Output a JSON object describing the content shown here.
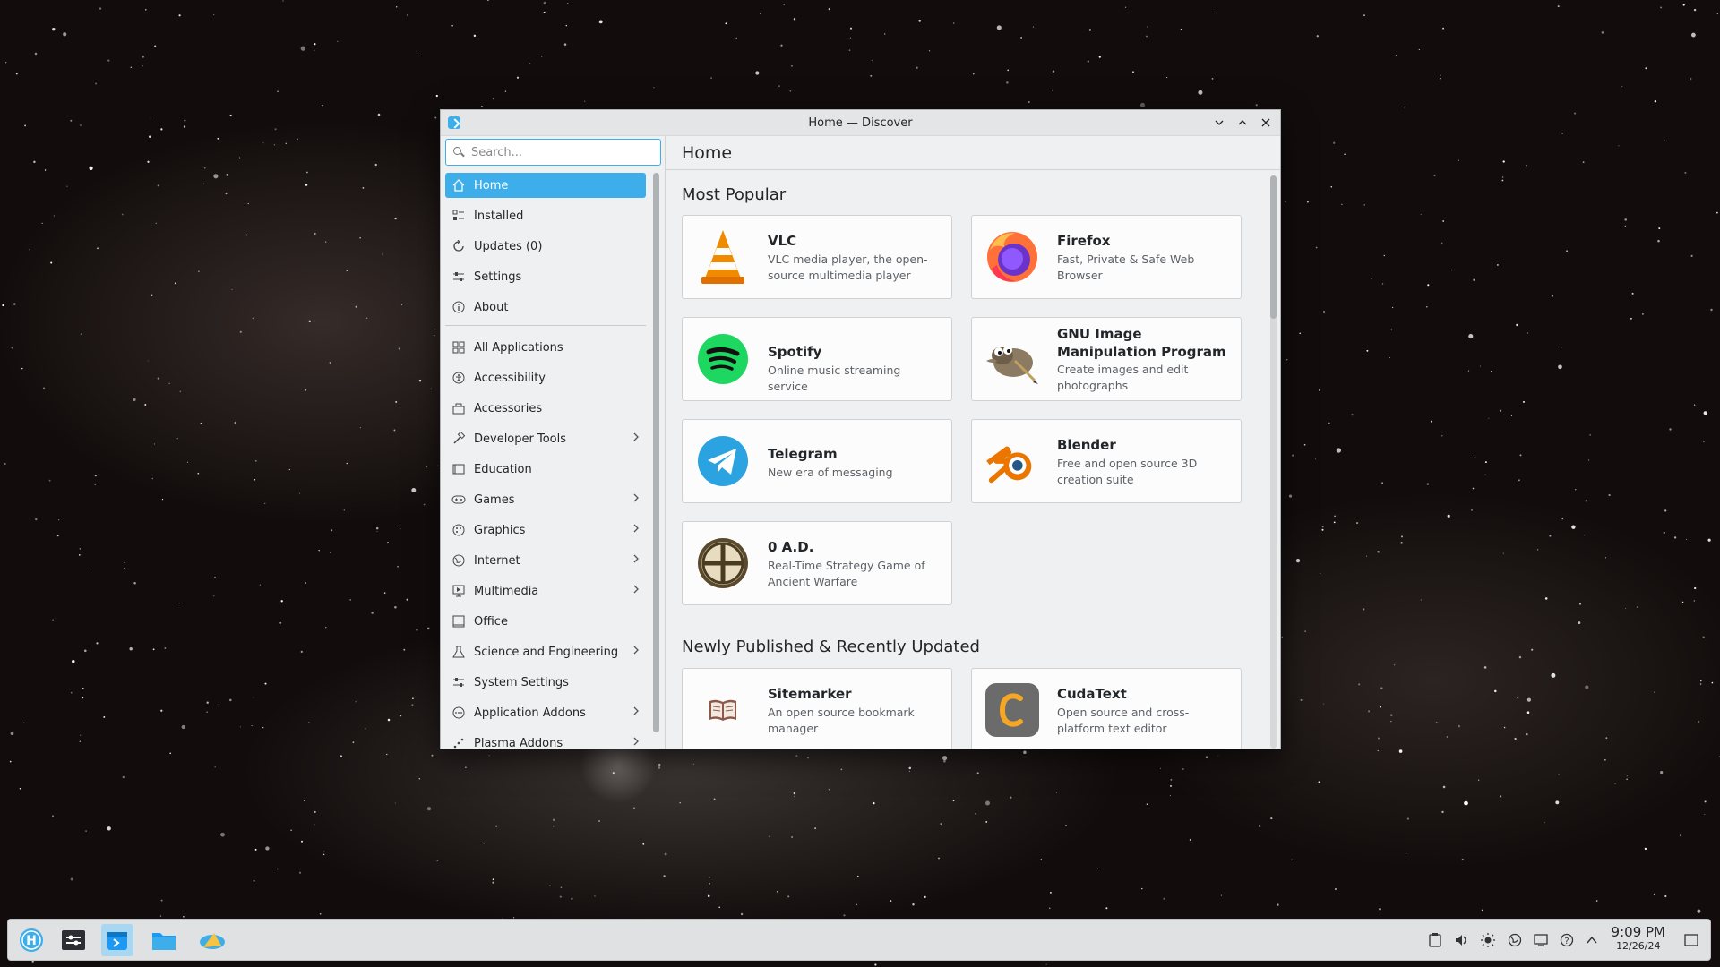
{
  "window": {
    "title": "Home — Discover"
  },
  "search": {
    "placeholder": "Search..."
  },
  "sidebar": {
    "top_items": [
      {
        "label": "Home",
        "icon": "home-icon",
        "active": true
      },
      {
        "label": "Installed",
        "icon": "installed-icon"
      },
      {
        "label": "Updates (0)",
        "icon": "updates-icon"
      },
      {
        "label": "Settings",
        "icon": "settings-icon"
      },
      {
        "label": "About",
        "icon": "about-icon"
      }
    ],
    "categories": [
      {
        "label": "All Applications",
        "icon": "grid-icon",
        "chevron": false
      },
      {
        "label": "Accessibility",
        "icon": "accessibility-icon",
        "chevron": false
      },
      {
        "label": "Accessories",
        "icon": "accessories-icon",
        "chevron": false
      },
      {
        "label": "Developer Tools",
        "icon": "hammer-icon",
        "chevron": true
      },
      {
        "label": "Education",
        "icon": "education-icon",
        "chevron": false
      },
      {
        "label": "Games",
        "icon": "gamepad-icon",
        "chevron": true
      },
      {
        "label": "Graphics",
        "icon": "graphics-icon",
        "chevron": true
      },
      {
        "label": "Internet",
        "icon": "globe-icon",
        "chevron": true
      },
      {
        "label": "Multimedia",
        "icon": "multimedia-icon",
        "chevron": true
      },
      {
        "label": "Office",
        "icon": "office-icon",
        "chevron": false
      },
      {
        "label": "Science and Engineering",
        "icon": "flask-icon",
        "chevron": true
      },
      {
        "label": "System Settings",
        "icon": "sliders-icon",
        "chevron": false
      },
      {
        "label": "Application Addons",
        "icon": "addons-icon",
        "chevron": true
      },
      {
        "label": "Plasma Addons",
        "icon": "plasma-icon",
        "chevron": true
      }
    ]
  },
  "main": {
    "header": "Home",
    "most_popular_title": "Most Popular",
    "newly_title": "Newly Published & Recently Updated",
    "most_popular": [
      {
        "name": "VLC",
        "desc": "VLC media player, the open-source multimedia player",
        "icon": "vlc-icon"
      },
      {
        "name": "Firefox",
        "desc": "Fast, Private & Safe Web Browser",
        "icon": "firefox-icon"
      },
      {
        "name": "Spotify",
        "desc": "Online music streaming service",
        "icon": "spotify-icon"
      },
      {
        "name": "GNU Image Manipulation Program",
        "desc": "Create images and edit photographs",
        "icon": "gimp-icon"
      },
      {
        "name": "Telegram",
        "desc": "New era of messaging",
        "icon": "telegram-icon"
      },
      {
        "name": "Blender",
        "desc": "Free and open source 3D creation suite",
        "icon": "blender-icon"
      },
      {
        "name": "0 A.D.",
        "desc": "Real-Time Strategy Game of Ancient Warfare",
        "icon": "0ad-icon"
      }
    ],
    "newly": [
      {
        "name": "Sitemarker",
        "desc": "An open source bookmark manager",
        "icon": "sitemarker-icon"
      },
      {
        "name": "CudaText",
        "desc": "Open source and cross-platform text editor",
        "icon": "cudatext-icon"
      }
    ]
  },
  "taskbar": {
    "time": "9:09 PM",
    "date": "12/26/24"
  },
  "colors": {
    "accent": "#3daee9",
    "window_bg": "#eff0f1"
  }
}
